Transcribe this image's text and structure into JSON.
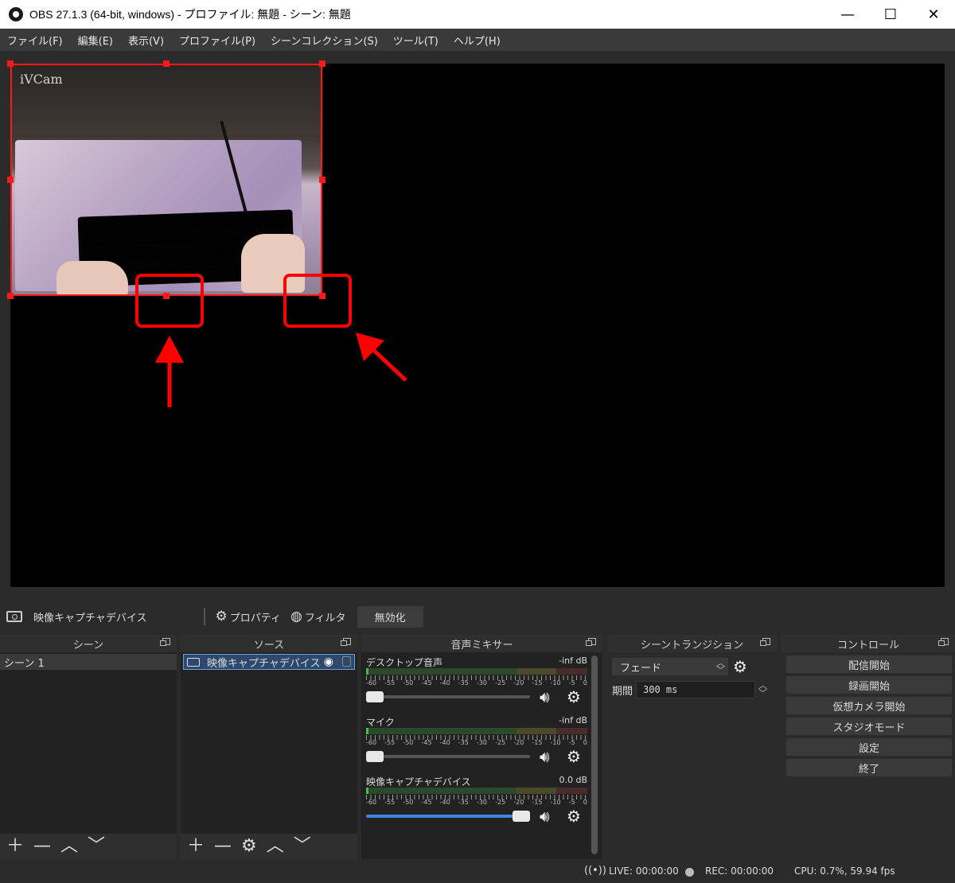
{
  "window": {
    "title": "OBS 27.1.3 (64-bit, windows) - プロファイル: 無題 - シーン: 無題",
    "minimize": "—",
    "maximize": "☐",
    "close": "✕"
  },
  "menu": [
    "ファイル(F)",
    "編集(E)",
    "表示(V)",
    "プロファイル(P)",
    "シーンコレクション(S)",
    "ツール(T)",
    "ヘルプ(H)"
  ],
  "preview": {
    "source_watermark": "iVCam",
    "accent_color": "#ff1a1a"
  },
  "source_toolbar": {
    "source_name": "映像キャプチャデバイス",
    "properties": "プロパティ",
    "filters": "フィルタ",
    "disable": "無効化"
  },
  "scenes": {
    "header": "シーン",
    "items": [
      "シーン 1"
    ]
  },
  "sources": {
    "header": "ソース",
    "items": [
      "映像キャプチャデバイス"
    ]
  },
  "mixer": {
    "header": "音声ミキサー",
    "scale": [
      "-60",
      "-55",
      "-50",
      "-45",
      "-40",
      "-35",
      "-30",
      "-25",
      "-20",
      "-15",
      "-10",
      "-5",
      "0"
    ],
    "channels": [
      {
        "name": "デスクトップ音声",
        "db": "-inf dB",
        "fader": 0.0
      },
      {
        "name": "マイク",
        "db": "-inf dB",
        "fader": 0.0
      },
      {
        "name": "映像キャプチャデバイス",
        "db": "0.0 dB",
        "fader": 1.0
      }
    ]
  },
  "transitions": {
    "header": "シーントランジション",
    "selected": "フェード",
    "duration_label": "期間",
    "duration_value": "300 ms"
  },
  "controls": {
    "header": "コントロール",
    "buttons": [
      "配信開始",
      "録画開始",
      "仮想カメラ開始",
      "スタジオモード",
      "設定",
      "終了"
    ]
  },
  "status": {
    "live": "LIVE: 00:00:00",
    "rec": "REC: 00:00:00",
    "cpu": "CPU: 0.7%, 59.94 fps"
  }
}
